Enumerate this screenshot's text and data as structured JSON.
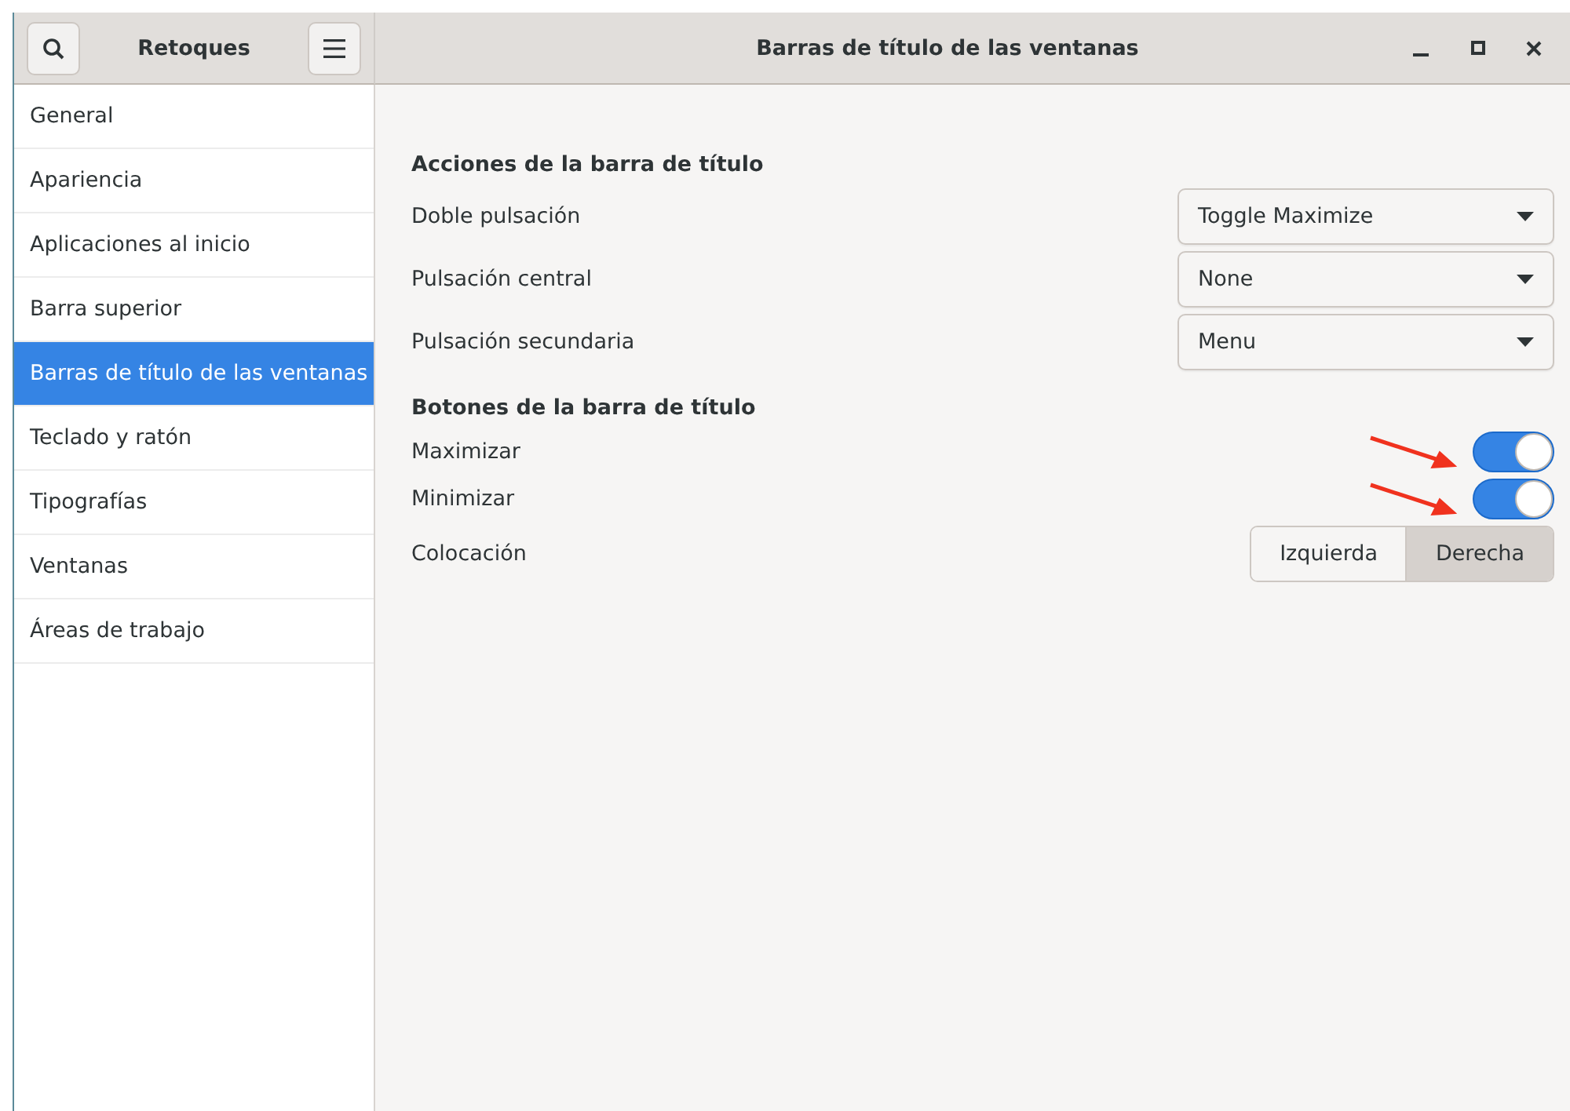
{
  "sidebar": {
    "title": "Retoques",
    "items": [
      {
        "label": "General",
        "selected": false
      },
      {
        "label": "Apariencia",
        "selected": false
      },
      {
        "label": "Aplicaciones al inicio",
        "selected": false
      },
      {
        "label": "Barra superior",
        "selected": false
      },
      {
        "label": "Barras de título de las ventanas",
        "selected": true
      },
      {
        "label": "Teclado y ratón",
        "selected": false
      },
      {
        "label": "Tipografías",
        "selected": false
      },
      {
        "label": "Ventanas",
        "selected": false
      },
      {
        "label": "Áreas de trabajo",
        "selected": false
      }
    ]
  },
  "header": {
    "title": "Barras de título de las ventanas"
  },
  "sections": [
    {
      "heading": "Acciones de la barra de título",
      "rows": [
        {
          "kind": "dropdown",
          "label": "Doble pulsación",
          "value": "Toggle Maximize"
        },
        {
          "kind": "dropdown",
          "label": "Pulsación central",
          "value": "None"
        },
        {
          "kind": "dropdown",
          "label": "Pulsación secundaria",
          "value": "Menu"
        }
      ]
    },
    {
      "heading": "Botones de la barra de título",
      "rows": [
        {
          "kind": "switch",
          "label": "Maximizar",
          "on": true,
          "annotated": true
        },
        {
          "kind": "switch",
          "label": "Minimizar",
          "on": true,
          "annotated": true
        },
        {
          "kind": "segmented",
          "label": "Colocación",
          "options": [
            {
              "label": "Izquierda",
              "selected": false
            },
            {
              "label": "Derecha",
              "selected": true
            }
          ]
        }
      ]
    }
  ]
}
